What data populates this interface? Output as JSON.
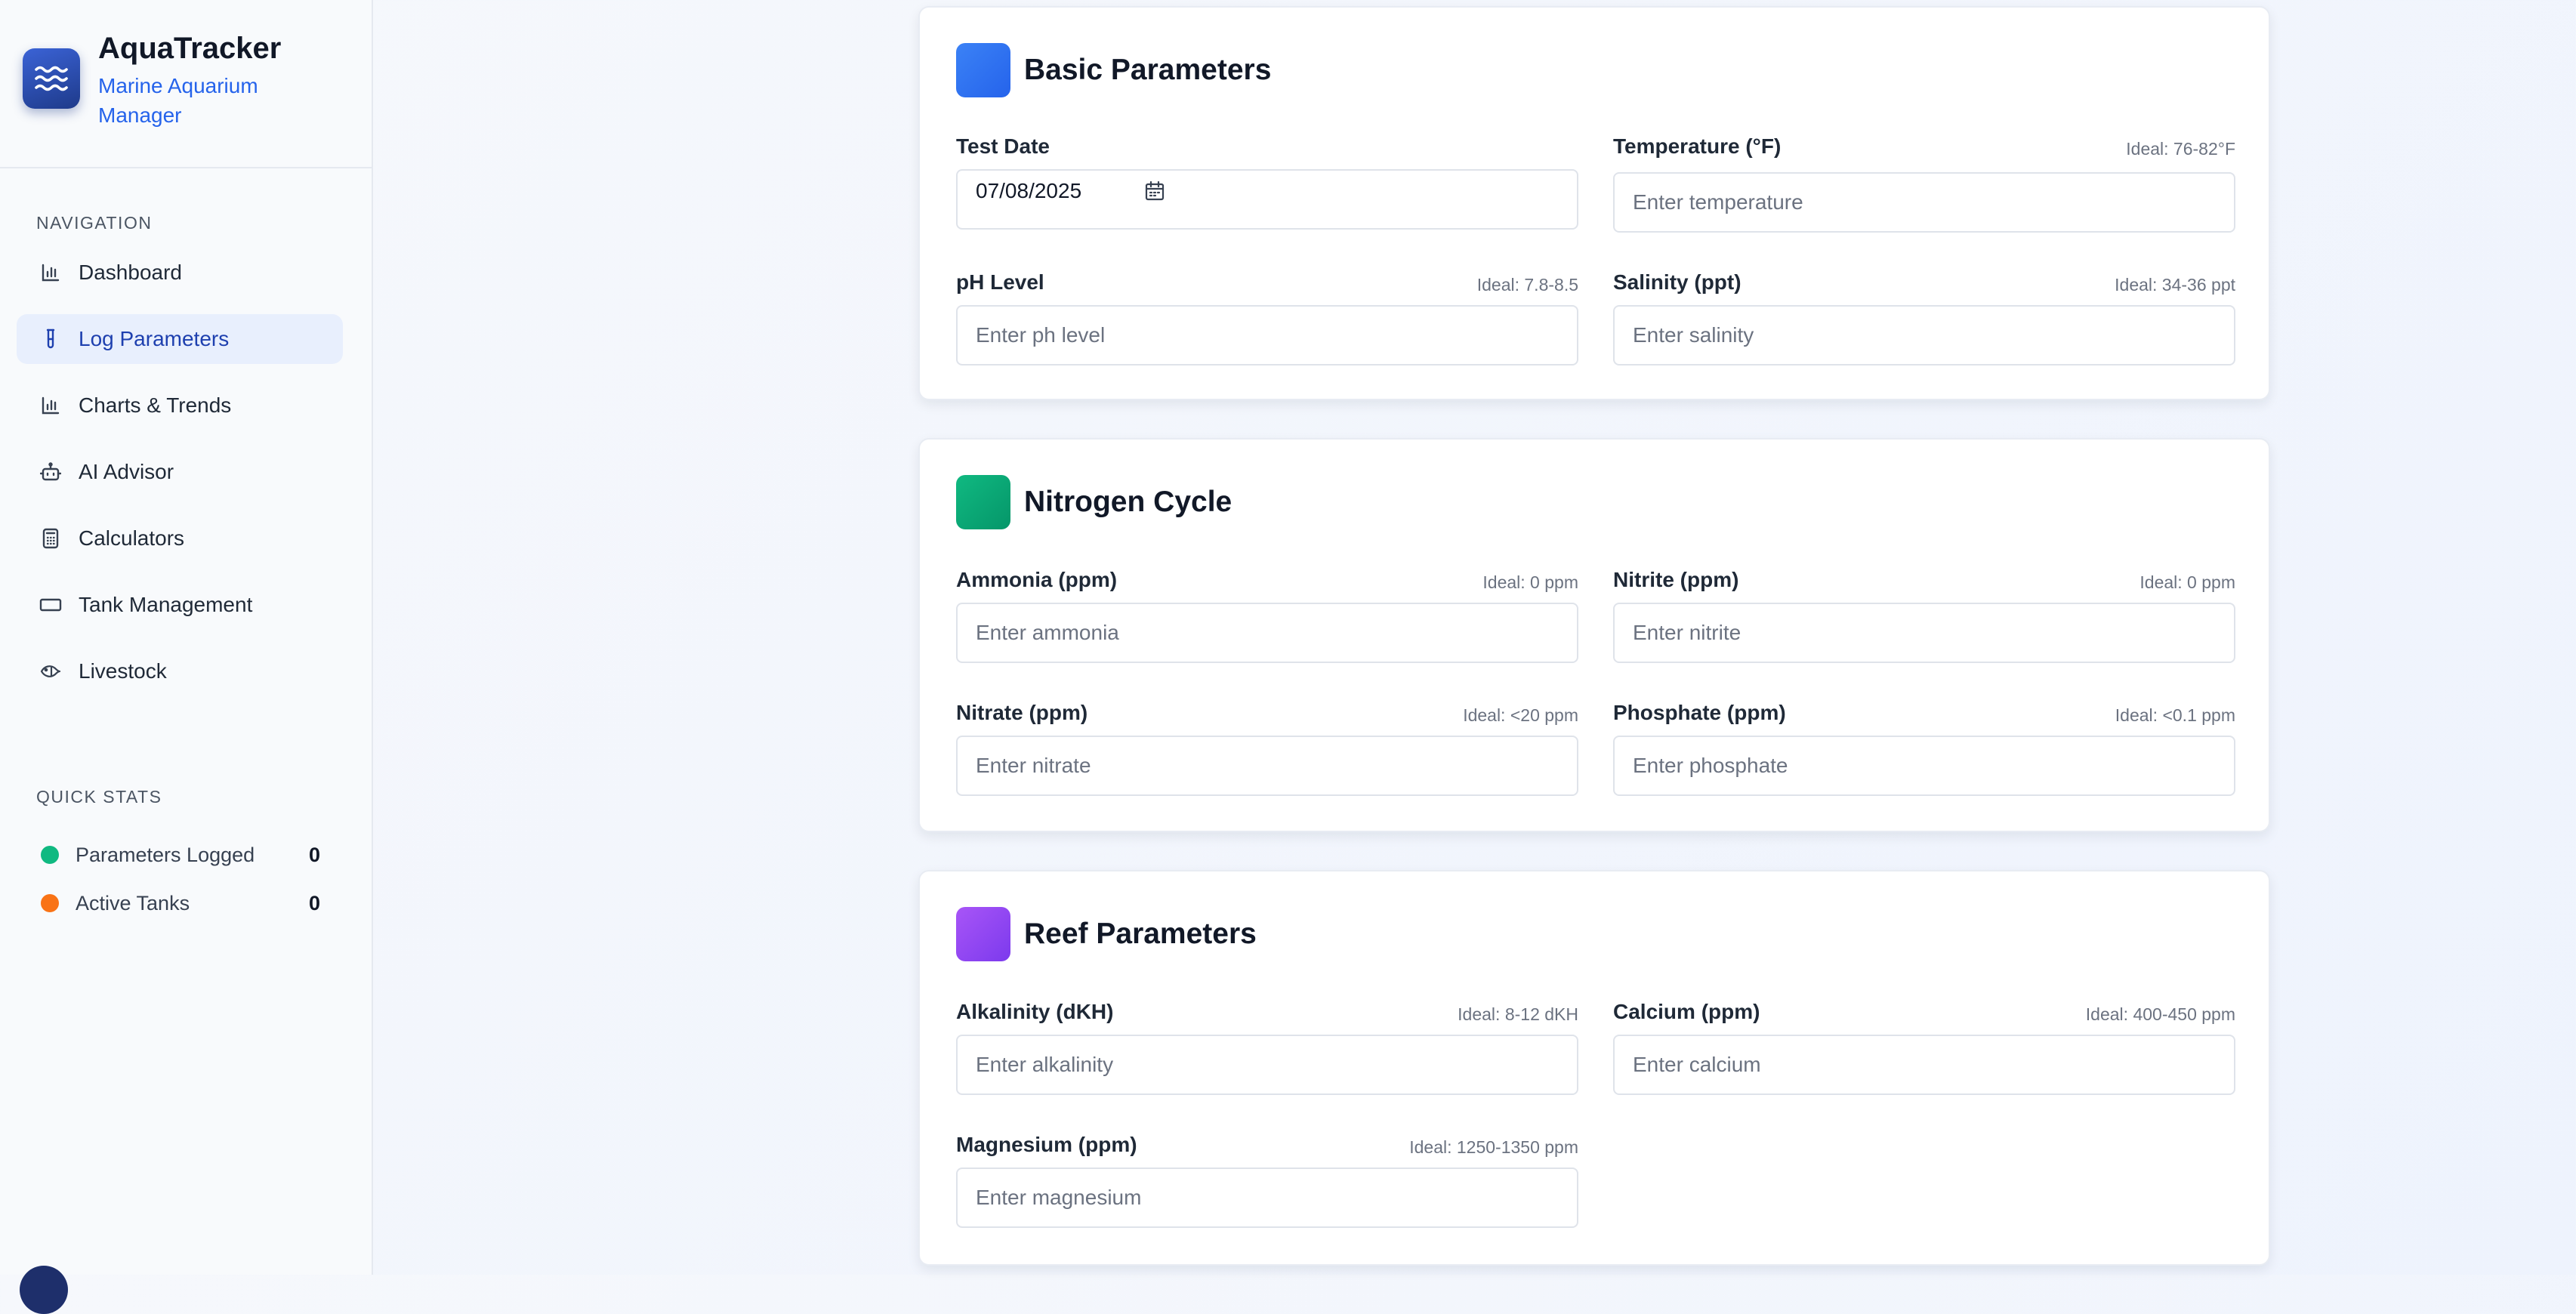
{
  "brand": {
    "title": "AquaTracker",
    "subtitle": "Marine Aquarium Manager"
  },
  "navigation": {
    "label": "NAVIGATION",
    "items": [
      {
        "label": "Dashboard",
        "icon": "bar-chart-icon",
        "active": false
      },
      {
        "label": "Log Parameters",
        "icon": "test-tube-icon",
        "active": true
      },
      {
        "label": "Charts & Trends",
        "icon": "bar-chart-icon",
        "active": false
      },
      {
        "label": "AI Advisor",
        "icon": "robot-icon",
        "active": false
      },
      {
        "label": "Calculators",
        "icon": "calculator-icon",
        "active": false
      },
      {
        "label": "Tank Management",
        "icon": "tank-icon",
        "active": false
      },
      {
        "label": "Livestock",
        "icon": "fish-icon",
        "active": false
      }
    ]
  },
  "quick_stats": {
    "label": "QUICK STATS",
    "items": [
      {
        "label": "Parameters Logged",
        "value": "0",
        "color": "#10b981"
      },
      {
        "label": "Active Tanks",
        "value": "0",
        "color": "#f97316"
      }
    ]
  },
  "sections": {
    "basic": {
      "title": "Basic Parameters",
      "color_from": "#3b82f6",
      "color_to": "#2563eb",
      "test_date": {
        "label": "Test Date",
        "value": "07/08/2025"
      },
      "temperature": {
        "label": "Temperature (°F)",
        "ideal": "Ideal: 76-82°F",
        "placeholder": "Enter temperature"
      },
      "ph": {
        "label": "pH Level",
        "ideal": "Ideal: 7.8-8.5",
        "placeholder": "Enter ph level"
      },
      "salinity": {
        "label": "Salinity (ppt)",
        "ideal": "Ideal: 34-36 ppt",
        "placeholder": "Enter salinity"
      }
    },
    "nitrogen": {
      "title": "Nitrogen Cycle",
      "color_from": "#10b981",
      "color_to": "#059669",
      "ammonia": {
        "label": "Ammonia (ppm)",
        "ideal": "Ideal: 0 ppm",
        "placeholder": "Enter ammonia"
      },
      "nitrite": {
        "label": "Nitrite (ppm)",
        "ideal": "Ideal: 0 ppm",
        "placeholder": "Enter nitrite"
      },
      "nitrate": {
        "label": "Nitrate (ppm)",
        "ideal": "Ideal: <20 ppm",
        "placeholder": "Enter nitrate"
      },
      "phosphate": {
        "label": "Phosphate (ppm)",
        "ideal": "Ideal: <0.1 ppm",
        "placeholder": "Enter phosphate"
      }
    },
    "reef": {
      "title": "Reef Parameters",
      "color_from": "#a855f7",
      "color_to": "#7c3aed",
      "alkalinity": {
        "label": "Alkalinity (dKH)",
        "ideal": "Ideal: 8-12 dKH",
        "placeholder": "Enter alkalinity"
      },
      "calcium": {
        "label": "Calcium (ppm)",
        "ideal": "Ideal: 400-450 ppm",
        "placeholder": "Enter calcium"
      },
      "magnesium": {
        "label": "Magnesium (ppm)",
        "ideal": "Ideal: 1250-1350 ppm",
        "placeholder": "Enter magnesium"
      }
    }
  }
}
